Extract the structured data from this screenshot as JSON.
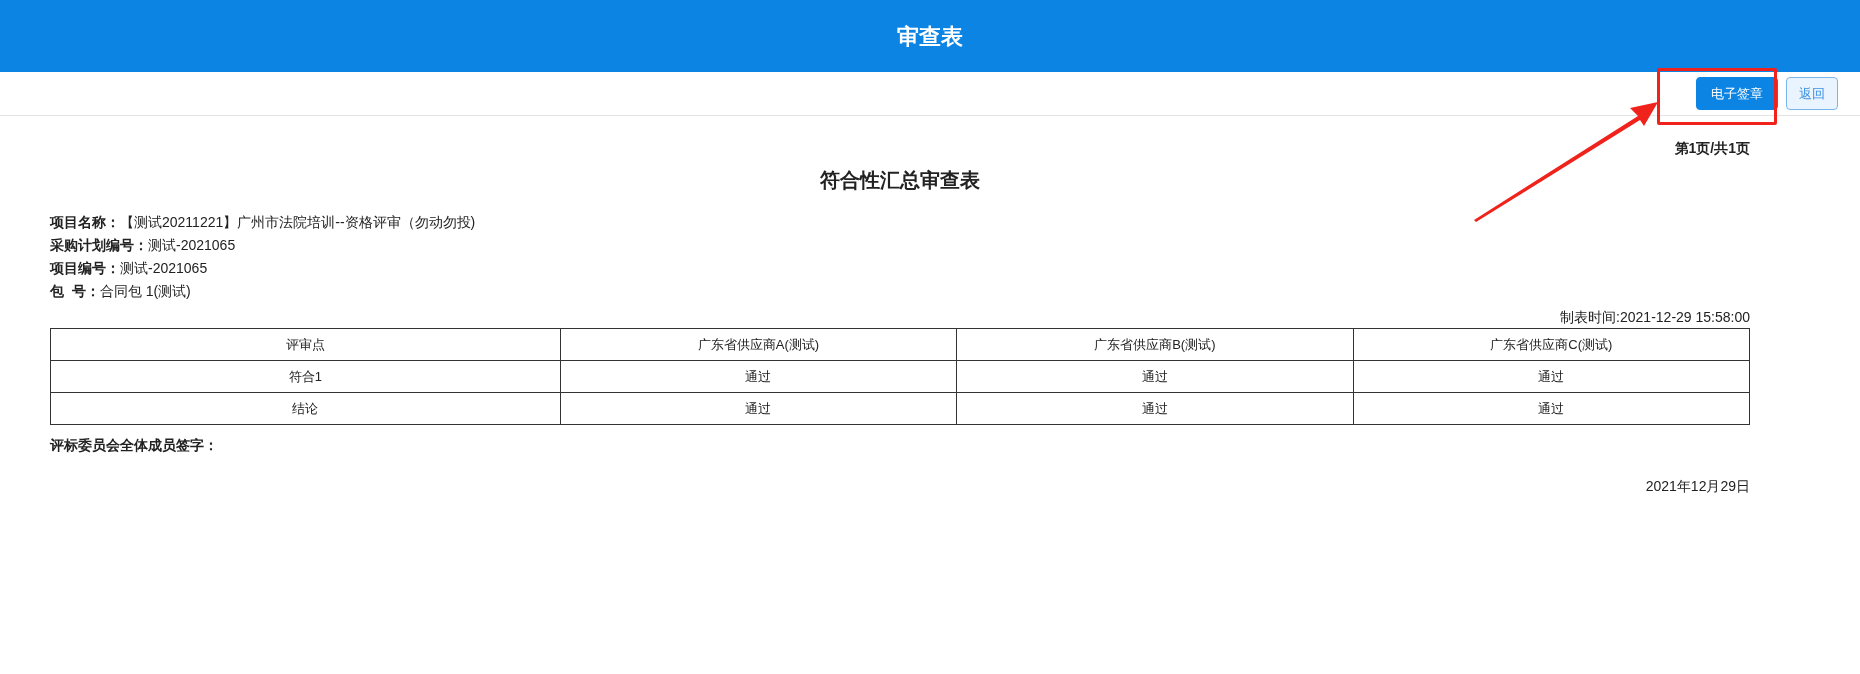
{
  "header": {
    "title": "审查表"
  },
  "toolbar": {
    "buttons": [
      {
        "label": "电子签章",
        "kind": "primary"
      },
      {
        "label": "返回",
        "kind": "outline"
      }
    ]
  },
  "document": {
    "page_info": "第1页/共1页",
    "title": "符合性汇总审查表",
    "fields": [
      {
        "label": "项目名称：",
        "value": "【测试20211221】广州市法院培训--资格评审（勿动勿投)"
      },
      {
        "label": "采购计划编号：",
        "value": "测试-2021065"
      },
      {
        "label": "项目编号：",
        "value": "测试-2021065"
      },
      {
        "label": "包  号：",
        "value": "合同包 1(测试)"
      }
    ],
    "made_time": "制表时间:2021-12-29 15:58:00",
    "table": {
      "columns": [
        "评审点",
        "广东省供应商A(测试)",
        "广东省供应商B(测试)",
        "广东省供应商C(测试)"
      ],
      "rows": [
        [
          "符合1",
          "通过",
          "通过",
          "通过"
        ],
        [
          "结论",
          "通过",
          "通过",
          "通过"
        ]
      ]
    },
    "signature_label": "评标委员会全体成员签字：",
    "date": "2021年12月29日"
  }
}
